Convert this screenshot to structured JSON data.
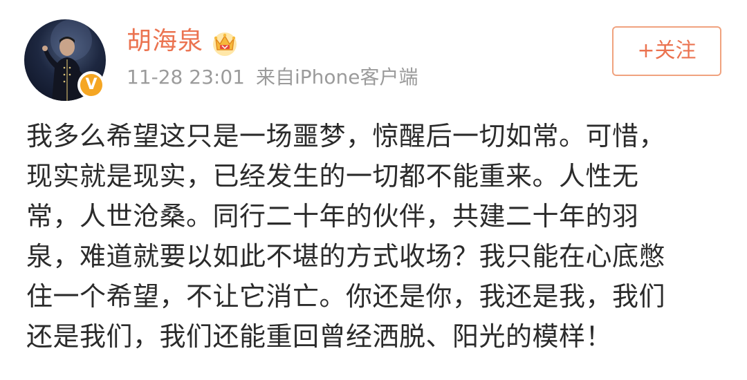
{
  "author": {
    "name": "胡海泉",
    "verified_badge": "V",
    "avatar_icon": "user-avatar",
    "membership_icon": "crown-icon"
  },
  "meta": {
    "time": "11-28 23:01",
    "source": "来自iPhone客户端"
  },
  "follow_button": {
    "label": "+关注"
  },
  "content": {
    "lines": [
      "我多么希望这只是一场噩梦，惊醒后一切如常。可惜，",
      "现实就是现实，已经发生的一切都不能重来。人性无",
      "常，人世沧桑。同行二十年的伙伴，共建二十年的羽",
      "泉，难道就要以如此不堪的方式收场？我只能在心底憋",
      "住一个希望，不让它消亡。你还是你，我还是我，我们",
      "还是我们，我们还能重回曾经洒脱、阳光的模样！"
    ]
  },
  "colors": {
    "name": "#eb7350",
    "meta": "#9b9b9b",
    "text": "#2b2b2b",
    "follow_border": "#f0a27e",
    "verified": "#f5a623"
  }
}
